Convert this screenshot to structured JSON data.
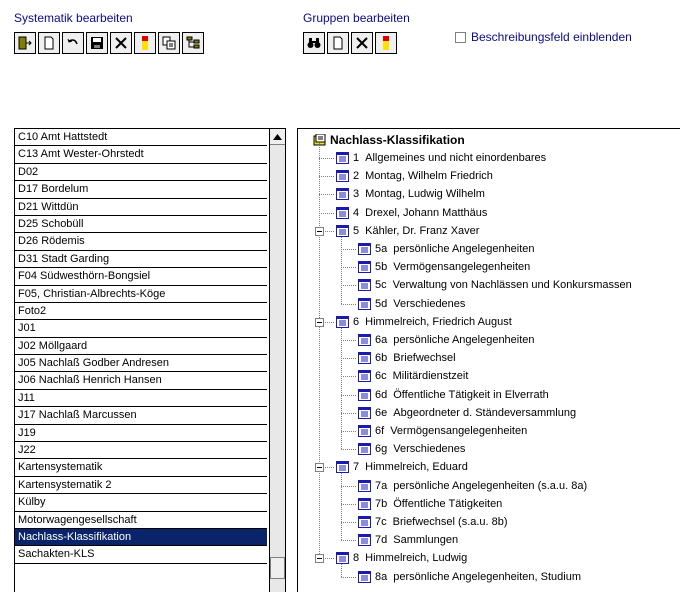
{
  "systematik": {
    "title": "Systematik bearbeiten",
    "toolbar": [
      {
        "name": "exit-button",
        "icon": "exit-door-icon"
      },
      {
        "name": "new-button",
        "icon": "new-document-icon"
      },
      {
        "name": "undo-button",
        "icon": "undo-icon"
      },
      {
        "name": "save-button",
        "icon": "floppy-disk-icon"
      },
      {
        "name": "delete-button",
        "icon": "delete-x-icon"
      },
      {
        "name": "color-button",
        "icon": "color-bar-icon"
      },
      {
        "name": "copy-button",
        "icon": "copy-icon"
      },
      {
        "name": "properties-button",
        "icon": "properties-icon"
      }
    ]
  },
  "gruppen": {
    "title": "Gruppen bearbeiten",
    "toolbar": [
      {
        "name": "search-button",
        "icon": "binoculars-icon"
      },
      {
        "name": "new-group-button",
        "icon": "new-document-icon"
      },
      {
        "name": "delete-group-button",
        "icon": "delete-x-icon"
      },
      {
        "name": "group-color-button",
        "icon": "color-bar-icon"
      }
    ],
    "checkbox_label": "Beschreibungsfeld einblenden",
    "checkbox_checked": false
  },
  "list": {
    "items": [
      "C10 Amt Hattstedt",
      "C13 Amt Wester-Ohrstedt",
      "D02",
      "D17 Bordelum",
      "D21 Wittdün",
      "D25 Schobüll",
      "D26 Rödemis",
      "D31 Stadt Garding",
      "F04 Südwesthörn-Bongsiel",
      "F05, Christian-Albrechts-Köge",
      "Foto2",
      "J01",
      "J02 Möllgaard",
      "J05 Nachlaß Godber Andresen",
      "J06 Nachlaß Henrich Hansen",
      "J11",
      "J17 Nachlaß Marcussen",
      "J19",
      "J22",
      "Kartensystematik",
      "Kartensystematik 2",
      "Külby",
      "Motorwagengesellschaft",
      "Nachlass-Klassifikation",
      "Sachakten-KLS"
    ],
    "selected": "Nachlass-Klassifikation"
  },
  "tree": {
    "root": "Nachlass-Klassifikation",
    "nodes": [
      {
        "level": 1,
        "num": "1",
        "text": "Allgemeines und nicht einordenbares"
      },
      {
        "level": 1,
        "num": "2",
        "text": "Montag, Wilhelm Friedrich"
      },
      {
        "level": 1,
        "num": "3",
        "text": "Montag, Ludwig Wilhelm"
      },
      {
        "level": 1,
        "num": "4",
        "text": "Drexel, Johann Matthäus"
      },
      {
        "level": 1,
        "num": "5",
        "text": "Kähler, Dr. Franz Xaver",
        "expanded": true
      },
      {
        "level": 2,
        "num": "5a",
        "text": "persönliche Angelegenheiten"
      },
      {
        "level": 2,
        "num": "5b",
        "text": "Vermögensangelegenheiten"
      },
      {
        "level": 2,
        "num": "5c",
        "text": "Verwaltung von Nachlässen und Konkursmassen"
      },
      {
        "level": 2,
        "num": "5d",
        "text": "Verschiedenes"
      },
      {
        "level": 1,
        "num": "6",
        "text": "Himmelreich, Friedrich August",
        "expanded": true
      },
      {
        "level": 2,
        "num": "6a",
        "text": "persönliche Angelegenheiten"
      },
      {
        "level": 2,
        "num": "6b",
        "text": "Briefwechsel"
      },
      {
        "level": 2,
        "num": "6c",
        "text": "Militärdienstzeit"
      },
      {
        "level": 2,
        "num": "6d",
        "text": "Öffentliche Tätigkeit in Elverrath"
      },
      {
        "level": 2,
        "num": "6e",
        "text": "Abgeordneter d. Ständeversammlung"
      },
      {
        "level": 2,
        "num": "6f",
        "text": "Vermögensangelegenheiten"
      },
      {
        "level": 2,
        "num": "6g",
        "text": "Verschiedenes"
      },
      {
        "level": 1,
        "num": "7",
        "text": "Himmelreich, Eduard",
        "expanded": true
      },
      {
        "level": 2,
        "num": "7a",
        "text": "persönliche Angelegenheiten (s.a.u. 8a)"
      },
      {
        "level": 2,
        "num": "7b",
        "text": "Öffentliche Tätigkeiten"
      },
      {
        "level": 2,
        "num": "7c",
        "text": "Briefwechsel (s.a.u. 8b)"
      },
      {
        "level": 2,
        "num": "7d",
        "text": "Sammlungen"
      },
      {
        "level": 1,
        "num": "8",
        "text": "Himmelreich, Ludwig",
        "expanded": true
      },
      {
        "level": 2,
        "num": "8a",
        "text": "persönliche Angelegenheiten, Studium"
      }
    ]
  },
  "colors": {
    "label_blue": "#0a0a8c",
    "selection": "#0a246a",
    "doc_icon_blue": "#1a1ab0"
  }
}
